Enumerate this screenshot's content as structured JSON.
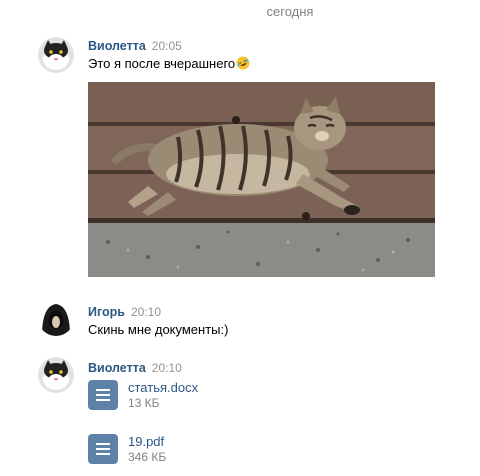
{
  "date_separator": "сегодня",
  "messages": [
    {
      "author": "Виолетта",
      "time": "20:05",
      "text": "Это я после вчерашнего",
      "emoji": "rofl-emoji",
      "attachment": "cat-photo"
    },
    {
      "author": "Игорь",
      "time": "20:10",
      "text": "Скинь мне документы:)"
    },
    {
      "author": "Виолетта",
      "time": "20:10",
      "documents": [
        {
          "name": "статья.docx",
          "size": "13 КБ"
        },
        {
          "name": "19.pdf",
          "size": "346 КБ"
        }
      ]
    }
  ],
  "colors": {
    "author": "#2a5885",
    "time": "#939393",
    "doc_icon": "#5e81a8",
    "meta": "#828282"
  }
}
